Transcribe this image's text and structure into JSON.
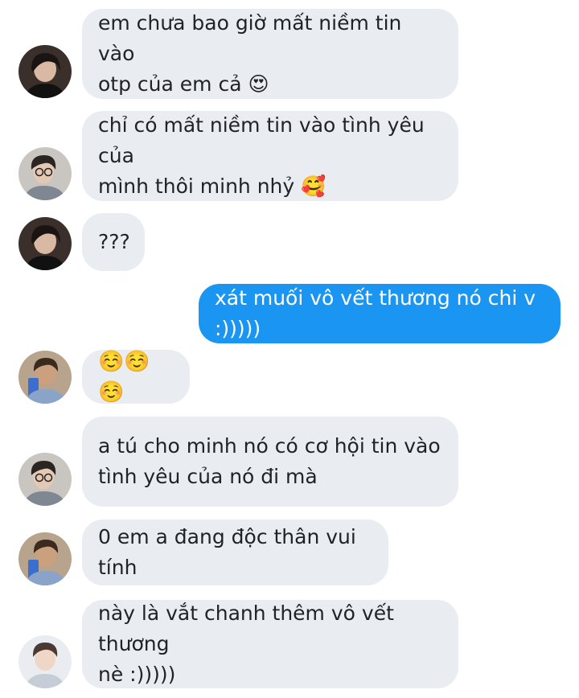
{
  "messages": [
    {
      "text": "em chưa bao giờ mất niềm tin vào\notp của em cả 😍",
      "avatar": "dark-hair-avatar"
    },
    {
      "text": "chỉ có mất niềm tin vào tình yêu của\nmình thôi minh nhỷ 🥰",
      "avatar": "glasses-avatar"
    },
    {
      "text": "???",
      "avatar": "dark-hair-avatar"
    },
    {
      "text": "xát muối vô vết thương nó chi v :)))))",
      "outgoing": true
    },
    {
      "text": "☺️☺️☺️",
      "avatar": "selfie-avatar"
    },
    {
      "text": "a tú cho minh nó có cơ hội tin vào\ntình yêu của nó đi mà",
      "avatar": "glasses-avatar"
    },
    {
      "text": "0 em a đang độc thân vui tính",
      "avatar": "selfie-avatar"
    },
    {
      "text": "này là vắt chanh thêm vô vết thương\nnè :)))))",
      "avatar": "light-avatar"
    }
  ]
}
